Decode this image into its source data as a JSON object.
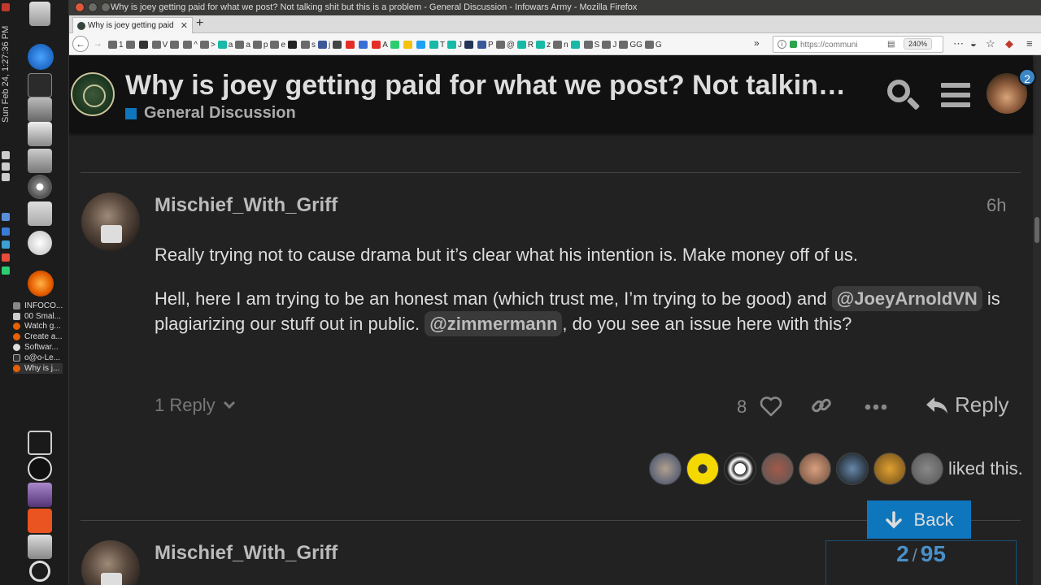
{
  "os": {
    "window_title": "Why is joey getting paid for what we post? Not talking shit but this is a problem - General Discussion - Infowars Army - Mozilla Firefox",
    "clock": "Sun Feb 24, 1:27:36 PM"
  },
  "taskbar": {
    "windows": [
      {
        "label": "INFOCO..."
      },
      {
        "label": "00 Smal..."
      },
      {
        "label": "Watch g..."
      },
      {
        "label": "Create a..."
      },
      {
        "label": "Softwar..."
      },
      {
        "label": "o@o-Le..."
      },
      {
        "label": "Why is j..."
      }
    ]
  },
  "browser": {
    "tab_title": "Why is joey getting paid",
    "url": "https://communi",
    "zoom": "240%",
    "bookmarks": [
      {
        "label": "1",
        "color": "#6b6b6b"
      },
      {
        "label": "",
        "color": "#6b6b6b"
      },
      {
        "label": "",
        "color": "#333333"
      },
      {
        "label": "V",
        "color": "#6b6b6b"
      },
      {
        "label": "",
        "color": "#6b6b6b"
      },
      {
        "label": "^",
        "color": "#6b6b6b"
      },
      {
        "label": ">",
        "color": "#6b6b6b"
      },
      {
        "label": "a",
        "color": "#18b9a7"
      },
      {
        "label": "a",
        "color": "#6b6b6b"
      },
      {
        "label": "p",
        "color": "#6b6b6b"
      },
      {
        "label": "e",
        "color": "#6b6b6b"
      },
      {
        "label": "",
        "color": "#222222"
      },
      {
        "label": "s",
        "color": "#6b6b6b"
      },
      {
        "label": "j",
        "color": "#3b5998"
      },
      {
        "label": "",
        "color": "#444444"
      },
      {
        "label": "",
        "color": "#e52d27"
      },
      {
        "label": "",
        "color": "#3a6fd8"
      },
      {
        "label": "A",
        "color": "#e52d27"
      },
      {
        "label": "",
        "color": "#2ecc71"
      },
      {
        "label": "",
        "color": "#f4c20d"
      },
      {
        "label": "",
        "color": "#1da1f2"
      },
      {
        "label": "T",
        "color": "#18b9a7"
      },
      {
        "label": "J",
        "color": "#18b9a7"
      },
      {
        "label": "",
        "color": "#223355"
      },
      {
        "label": "P",
        "color": "#3b5998"
      },
      {
        "label": "@",
        "color": "#6b6b6b"
      },
      {
        "label": "R",
        "color": "#18b9a7"
      },
      {
        "label": "z",
        "color": "#18b9a7"
      },
      {
        "label": "n",
        "color": "#6b6b6b"
      },
      {
        "label": "",
        "color": "#18b9a7"
      },
      {
        "label": "S",
        "color": "#6b6b6b"
      },
      {
        "label": "J",
        "color": "#6b6b6b"
      },
      {
        "label": "GG",
        "color": "#6b6b6b"
      },
      {
        "label": "G",
        "color": "#6b6b6b"
      }
    ]
  },
  "site": {
    "topic_title": "Why is joey getting paid for what we post? Not talkin…",
    "category": "General Discussion",
    "category_color": "#0e76bd",
    "notification_count": "2"
  },
  "post": {
    "username": "Mischief_With_Griff",
    "time": "6h",
    "p1": "Really trying not to cause drama but it’s clear what his intention is. Make money off of us.",
    "p2_a": "Hell, here I am trying to be an honest man (which trust me, I’m trying to be good) and",
    "mention1": "@JoeyArnoldVN",
    "p2_b": "is plagiarizing our stuff out in public.",
    "mention2": "@zimmermann",
    "p2_c": ", do you see an issue here with this?",
    "replies_label": "1 Reply",
    "like_count": "8",
    "reply_label": "Reply",
    "liked_text": "liked this."
  },
  "next_post": {
    "username": "Mischief_With_Griff"
  },
  "timeline": {
    "back_label": "Back",
    "current": "2",
    "separator": "/",
    "total": "95"
  }
}
